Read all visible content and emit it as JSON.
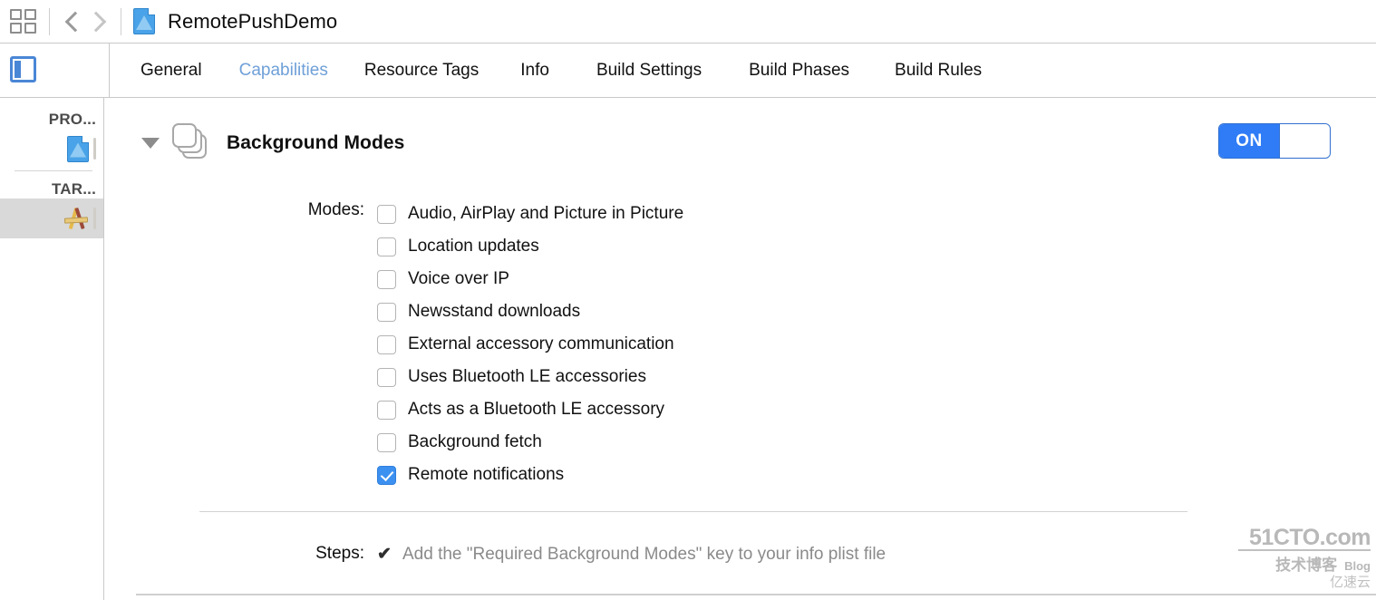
{
  "titlebar": {
    "grid_icon": "grid-icon",
    "back_icon": "chevron-left-icon",
    "forward_icon": "chevron-right-icon",
    "project_icon": "xcode-project-document-icon",
    "document_title": "RemotePushDemo"
  },
  "tabbar": {
    "sidebar_toggle_icon": "sidebar-toggle-icon",
    "tabs": [
      {
        "label": "General",
        "active": false
      },
      {
        "label": "Capabilities",
        "active": true
      },
      {
        "label": "Resource Tags",
        "active": false
      },
      {
        "label": "Info",
        "active": false
      },
      {
        "label": "Build Settings",
        "active": false
      },
      {
        "label": "Build Phases",
        "active": false
      },
      {
        "label": "Build Rules",
        "active": false
      }
    ],
    "active_color": "#6fa0d8"
  },
  "sidebar": {
    "project_section_label": "PRO...",
    "project_item_icon": "xcode-project-document-icon",
    "targets_section_label": "TAR...",
    "target_item_icon": "xcode-target-icon",
    "target_item_selected": true
  },
  "capability": {
    "disclosure_icon": "disclosure-triangle-down-icon",
    "icon": "stacked-cards-icon",
    "title": "Background Modes",
    "toggle": {
      "state_label": "ON",
      "enabled": true,
      "on_color": "#2f7cf6"
    }
  },
  "modes": {
    "label": "Modes:",
    "items": [
      {
        "label": "Audio, AirPlay and Picture in Picture",
        "checked": false
      },
      {
        "label": "Location updates",
        "checked": false
      },
      {
        "label": "Voice over IP",
        "checked": false
      },
      {
        "label": "Newsstand downloads",
        "checked": false
      },
      {
        "label": "External accessory communication",
        "checked": false
      },
      {
        "label": "Uses Bluetooth LE accessories",
        "checked": false
      },
      {
        "label": "Acts as a Bluetooth LE accessory",
        "checked": false
      },
      {
        "label": "Background fetch",
        "checked": false
      },
      {
        "label": "Remote notifications",
        "checked": true
      }
    ],
    "checked_color": "#3c90f0"
  },
  "steps": {
    "label": "Steps:",
    "items": [
      {
        "check": "✔",
        "text": "Add the \"Required Background Modes\" key to your info plist file"
      }
    ]
  },
  "watermark": {
    "main": "51CTO.com",
    "cn": "技术博客",
    "blog": "Blog",
    "third": "亿速云"
  }
}
